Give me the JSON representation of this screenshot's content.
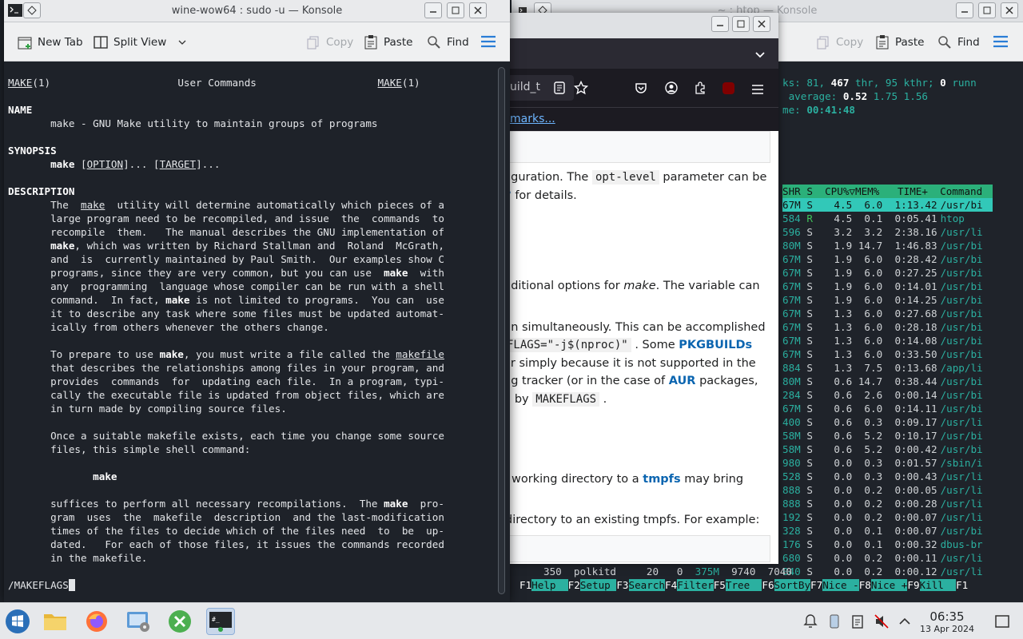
{
  "man_window": {
    "title": "wine-wow64 : sudo -u — Konsole",
    "toolbar": {
      "new_tab": "New Tab",
      "split_view": "Split View",
      "copy": "Copy",
      "paste": "Paste",
      "find": "Find"
    },
    "search_prompt": "/MAKEFLAGS"
  },
  "htop_window": {
    "title": "~ : htop — Konsole",
    "toolbar": {
      "copy": "Copy",
      "paste": "Paste",
      "find": "Find"
    },
    "header_line1_prefix": "ks: 81, ",
    "header_thr": "467",
    "header_thr_label": " thr, 95 kthr; ",
    "header_running": "0",
    "header_running_label": " runn",
    "load_label": " average: ",
    "load_1": "0.52",
    "load_rest": " 1.75 1.56",
    "uptime_label": "me: ",
    "uptime": "00:41:48",
    "columns": "SHR S  CPU%▽MEM%   TIME+  Command",
    "rows": [
      {
        "shr": "67M",
        "s": "S",
        "cpu": "4.5",
        "mem": "6.0",
        "time": "1:13.42",
        "cmd": "/usr/bi",
        "selected": true
      },
      {
        "shr": "584",
        "s": "R",
        "cpu": "4.5",
        "mem": "0.1",
        "time": "0:05.41",
        "cmd": "htop"
      },
      {
        "shr": "596",
        "s": "S",
        "cpu": "3.2",
        "mem": "3.2",
        "time": "2:38.16",
        "cmd": "/usr/li"
      },
      {
        "shr": "80M",
        "s": "S",
        "cpu": "1.9",
        "mem": "14.7",
        "time": "1:46.83",
        "cmd": "/usr/bi"
      },
      {
        "shr": "67M",
        "s": "S",
        "cpu": "1.9",
        "mem": "6.0",
        "time": "0:28.42",
        "cmd": "/usr/bi"
      },
      {
        "shr": "67M",
        "s": "S",
        "cpu": "1.9",
        "mem": "6.0",
        "time": "0:27.25",
        "cmd": "/usr/bi"
      },
      {
        "shr": "67M",
        "s": "S",
        "cpu": "1.9",
        "mem": "6.0",
        "time": "0:14.01",
        "cmd": "/usr/bi"
      },
      {
        "shr": "67M",
        "s": "S",
        "cpu": "1.9",
        "mem": "6.0",
        "time": "0:14.25",
        "cmd": "/usr/bi"
      },
      {
        "shr": "67M",
        "s": "S",
        "cpu": "1.3",
        "mem": "6.0",
        "time": "0:27.68",
        "cmd": "/usr/bi"
      },
      {
        "shr": "67M",
        "s": "S",
        "cpu": "1.3",
        "mem": "6.0",
        "time": "0:28.18",
        "cmd": "/usr/bi"
      },
      {
        "shr": "67M",
        "s": "S",
        "cpu": "1.3",
        "mem": "6.0",
        "time": "0:14.08",
        "cmd": "/usr/bi"
      },
      {
        "shr": "67M",
        "s": "S",
        "cpu": "1.3",
        "mem": "6.0",
        "time": "0:33.50",
        "cmd": "/usr/bi"
      },
      {
        "shr": "884",
        "s": "S",
        "cpu": "1.3",
        "mem": "7.5",
        "time": "0:13.68",
        "cmd": "/app/li"
      },
      {
        "shr": "80M",
        "s": "S",
        "cpu": "0.6",
        "mem": "14.7",
        "time": "0:38.44",
        "cmd": "/usr/bi"
      },
      {
        "shr": "284",
        "s": "S",
        "cpu": "0.6",
        "mem": "2.6",
        "time": "0:00.14",
        "cmd": "/usr/bi"
      },
      {
        "shr": "67M",
        "s": "S",
        "cpu": "0.6",
        "mem": "6.0",
        "time": "0:14.11",
        "cmd": "/usr/bi"
      },
      {
        "shr": "400",
        "s": "S",
        "cpu": "0.6",
        "mem": "0.3",
        "time": "0:09.17",
        "cmd": "/usr/li"
      },
      {
        "shr": "58M",
        "s": "S",
        "cpu": "0.6",
        "mem": "5.2",
        "time": "0:10.17",
        "cmd": "/usr/bi"
      },
      {
        "shr": "58M",
        "s": "S",
        "cpu": "0.6",
        "mem": "5.2",
        "time": "0:00.42",
        "cmd": "/usr/bi"
      },
      {
        "shr": "980",
        "s": "S",
        "cpu": "0.0",
        "mem": "0.3",
        "time": "0:01.57",
        "cmd": "/sbin/i"
      },
      {
        "shr": "528",
        "s": "S",
        "cpu": "0.0",
        "mem": "0.3",
        "time": "0:00.43",
        "cmd": "/usr/li"
      },
      {
        "shr": "888",
        "s": "S",
        "cpu": "0.0",
        "mem": "0.2",
        "time": "0:00.05",
        "cmd": "/usr/li"
      },
      {
        "shr": "888",
        "s": "S",
        "cpu": "0.0",
        "mem": "0.2",
        "time": "0:00.28",
        "cmd": "/usr/li"
      },
      {
        "shr": "192",
        "s": "S",
        "cpu": "0.0",
        "mem": "0.2",
        "time": "0:00.07",
        "cmd": "/usr/li"
      },
      {
        "shr": "328",
        "s": "S",
        "cpu": "0.0",
        "mem": "0.1",
        "time": "0:00.07",
        "cmd": "/usr/bi"
      },
      {
        "shr": "176",
        "s": "S",
        "cpu": "0.0",
        "mem": "0.1",
        "time": "0:00.32",
        "cmd": "dbus-br"
      },
      {
        "shr": "680",
        "s": "S",
        "cpu": "0.0",
        "mem": "0.2",
        "time": "0:00.11",
        "cmd": "/usr/li"
      },
      {
        "shr": "040",
        "s": "S",
        "cpu": "0.0",
        "mem": "0.2",
        "time": "0:00.12",
        "cmd": "/usr/li"
      }
    ],
    "partial_row": {
      "pid": "350",
      "user": "polkitd",
      "pri": "20",
      "ni": "0",
      "virt": "375M",
      "res": "9740",
      "shr": "7040"
    },
    "fkeys": [
      {
        "key": "F1",
        "label": "Help  "
      },
      {
        "key": "F2",
        "label": "Setup "
      },
      {
        "key": "F3",
        "label": "Search"
      },
      {
        "key": "F4",
        "label": "Filter"
      },
      {
        "key": "F5",
        "label": "Tree  "
      },
      {
        "key": "F6",
        "label": "SortBy"
      },
      {
        "key": "F7",
        "label": "Nice -"
      },
      {
        "key": "F8",
        "label": "Nice +"
      },
      {
        "key": "F9",
        "label": "Kill  "
      },
      {
        "key": "F1",
        "label": ""
      }
    ]
  },
  "firefox": {
    "url_fragment": "uild_t",
    "bookmarks_link": "marks...",
    "para1_a": "figuration. The ",
    "para1_code": "opt-level",
    "para1_b": " parameter can be",
    "para1_c": "for details.",
    "para2_a": "dditional options for ",
    "para2_em": "make",
    "para2_b": ". The variable can",
    "para3_a": "un simultaneously. This can be accomplished",
    "para3_code": "FLAGS=\"-j$(nproc)\"",
    "para3_b": " . Some ",
    "para3_link": "PKGBUILDs",
    "para3_c": "or simply because it is not supported in the",
    "para3_d": "ug tracker (or in the case of ",
    "para3_link2": "AUR",
    "para3_e": " packages,",
    "para3_f": "d by ",
    "para3_code2": "MAKEFLAGS",
    "para3_g": " .",
    "para4_a": "working directory to a ",
    "para4_link": "tmpfs",
    "para4_b": " may bring",
    "para5": "directory to an existing tmpfs. For example:"
  },
  "taskbar": {
    "clock_time": "06:35",
    "clock_date": "13 Apr 2024"
  },
  "colors": {
    "htop_green": "#2bb0a0",
    "htop_selected": "#32c8b8",
    "konsole_bg": "#1e2229"
  }
}
